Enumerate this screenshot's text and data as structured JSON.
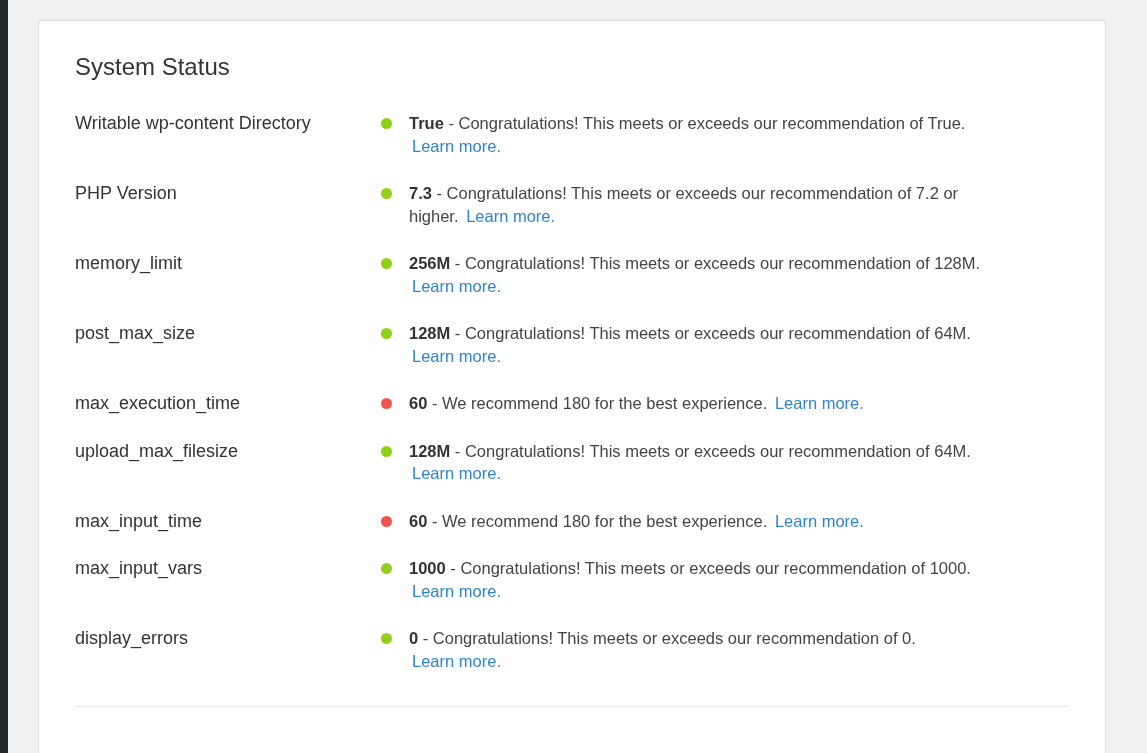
{
  "title": "System Status",
  "rows": [
    {
      "label": "Writable wp-content Directory",
      "color": "#8fd11a",
      "message": "**True** - Congratulations! This meets or exceeds our recommendation of True.",
      "link": "Learn more."
    },
    {
      "label": "PHP Version",
      "color": "#8fd11a",
      "message": "**7.3** - Congratulations! This meets or exceeds our recommendation of 7.2 or higher.",
      "link": "Learn more."
    },
    {
      "label": "memory_limit",
      "color": "#8fd11a",
      "message": "**256M** - Congratulations! This meets or exceeds our recommendation of 128M.",
      "link": "Learn more."
    },
    {
      "label": "post_max_size",
      "color": "#8fd11a",
      "message": "**128M** - Congratulations! This meets or exceeds our recommendation of 64M.",
      "link": "Learn more."
    },
    {
      "label": "max_execution_time",
      "color": "#ef5350",
      "message": "**60** - We recommend 180 for the best experience.",
      "link": "Learn more."
    },
    {
      "label": "upload_max_filesize",
      "color": "#8fd11a",
      "message": "**128M** - Congratulations! This meets or exceeds our recommendation of 64M.",
      "link": "Learn more."
    },
    {
      "label": "max_input_time",
      "color": "#ef5350",
      "message": "**60** - We recommend 180 for the best experience.",
      "link": "Learn more."
    },
    {
      "label": "max_input_vars",
      "color": "#8fd11a",
      "message": "**1000** - Congratulations! This meets or exceeds our recommendation of 1000.",
      "link": "Learn more."
    },
    {
      "label": "display_errors",
      "color": "#8fd11a",
      "message": "**0** - Congratulations! This meets or exceeds our recommendation of 0.",
      "link": "Learn more."
    }
  ]
}
